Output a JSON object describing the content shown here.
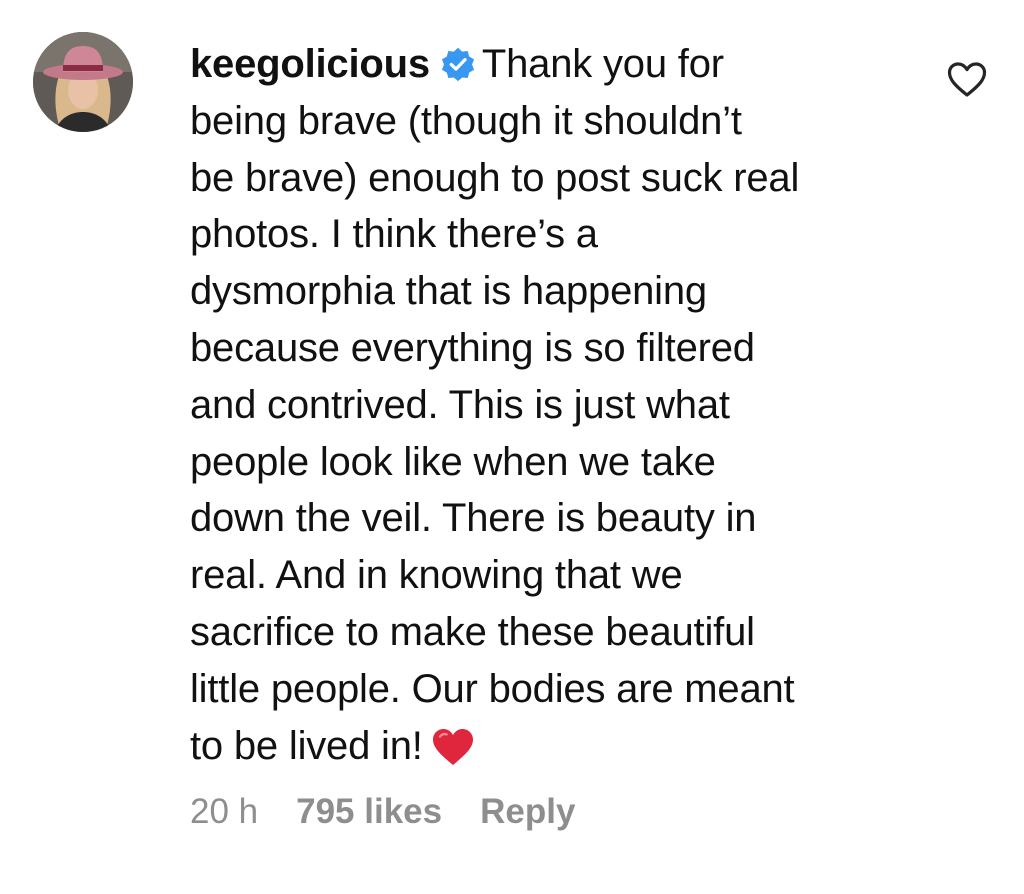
{
  "comment": {
    "username": "keegolicious",
    "verified": true,
    "text_lines": [
      "Thank you for",
      "being brave (though it shouldn’t",
      "be brave) enough to post suck real",
      "photos. I think there’s a",
      "dysmorphia that is happening",
      "because everything is so filtered",
      "and contrived. This is just what",
      "people look like when we take",
      "down the veil. There is beauty in",
      "real. And in knowing that we",
      "sacrifice to make these beautiful",
      "little people. Our bodies are meant",
      "to be lived in!"
    ],
    "emoji": "red-heart",
    "time_ago": "20 h",
    "likes": "795 likes",
    "reply_label": "Reply"
  },
  "icons": {
    "avatar": "profile-photo-woman-pink-hat",
    "verified": "verified-badge-icon",
    "like": "heart-outline-icon"
  },
  "colors": {
    "text": "#111111",
    "meta": "#8e8e8e",
    "verified_blue": "#3897f0",
    "heart_red": "#e0263c"
  }
}
